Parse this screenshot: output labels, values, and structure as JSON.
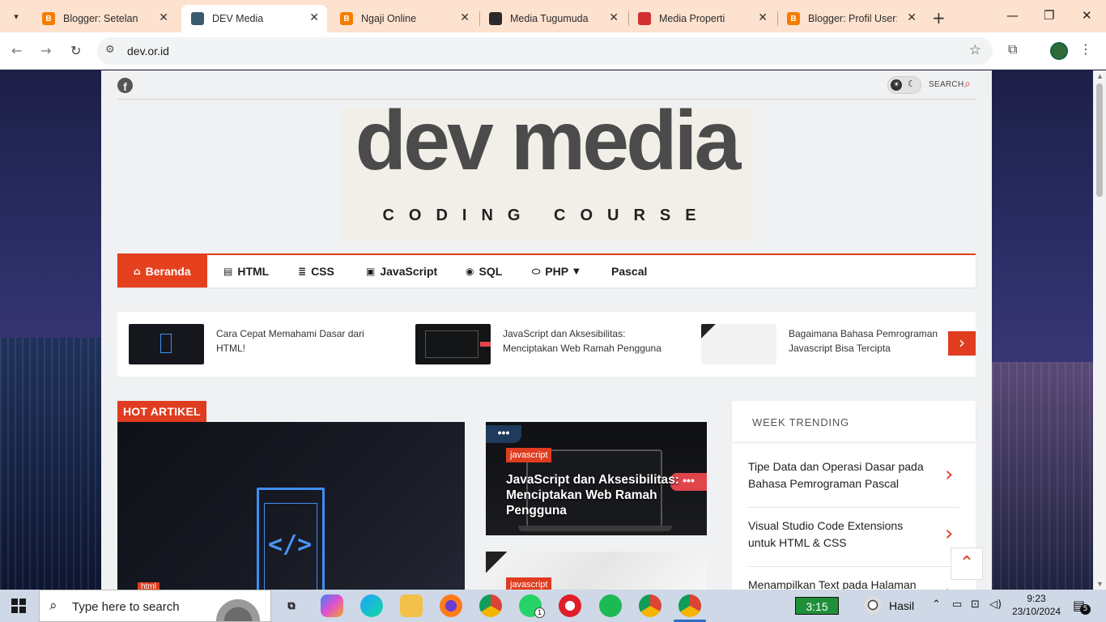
{
  "browser": {
    "tabs": [
      {
        "title": "Blogger: Setelan",
        "favicon": "blogger-icon",
        "color": "#f57d00",
        "active": false
      },
      {
        "title": "DEV Media",
        "favicon": "devmedia-icon",
        "color": "#3a5b6e",
        "active": true
      },
      {
        "title": "Ngaji Online",
        "favicon": "blogger-icon",
        "color": "#f57d00",
        "active": false
      },
      {
        "title": "Media Tugumuda",
        "favicon": "tugumuda-icon",
        "color": "#2a2a2a",
        "active": false
      },
      {
        "title": "Media Properti",
        "favicon": "properti-icon",
        "color": "#d32f2f",
        "active": false
      },
      {
        "title": "Blogger: Profil User: A",
        "favicon": "blogger-icon",
        "color": "#f57d00",
        "active": false
      }
    ],
    "url": "dev.or.id"
  },
  "site": {
    "logo_title": "dev media",
    "logo_subtitle": "CODING COURSE",
    "search_label": "SEARCH",
    "menu": [
      {
        "label": "Beranda",
        "icon": "home-icon"
      },
      {
        "label": "HTML",
        "icon": "html5-icon"
      },
      {
        "label": "CSS",
        "icon": "css3-icon"
      },
      {
        "label": "JavaScript",
        "icon": "js-icon"
      },
      {
        "label": "SQL",
        "icon": "database-icon"
      },
      {
        "label": "PHP",
        "icon": "php-icon"
      },
      {
        "label": "Pascal",
        "icon": ""
      }
    ],
    "ticker": [
      {
        "title": "Cara Cepat Memahami Dasar dari HTML!"
      },
      {
        "title": "JavaScript dan Aksesibilitas: Menciptakan Web Ramah Pengguna"
      },
      {
        "title": "Bagaimana Bahasa Pemrograman Javascript Bisa Tercipta"
      }
    ],
    "hot_label": "HOT ARTIKEL",
    "hot_main": {
      "code_glyph": "</>",
      "tag": "html"
    },
    "cards": [
      {
        "tag": "javascript",
        "title": "JavaScript dan Aksesibilitas: Menciptakan Web Ramah Pengguna",
        "dots": "•••"
      },
      {
        "tag": "javascript"
      }
    ],
    "trending_title": "WEEK TRENDING",
    "trending": [
      "Tipe Data dan Operasi Dasar pada Bahasa Pemrograman Pascal",
      "Visual Studio Code Extensions untuk HTML & CSS",
      "Menampilkan Text pada Halaman"
    ]
  },
  "taskbar": {
    "search_placeholder": "Type here to search",
    "clock_app": "3:15",
    "weather_text": "Hasil",
    "time": "9:23",
    "date": "23/10/2024",
    "notifications": "5",
    "whatsapp_badge": "1"
  }
}
